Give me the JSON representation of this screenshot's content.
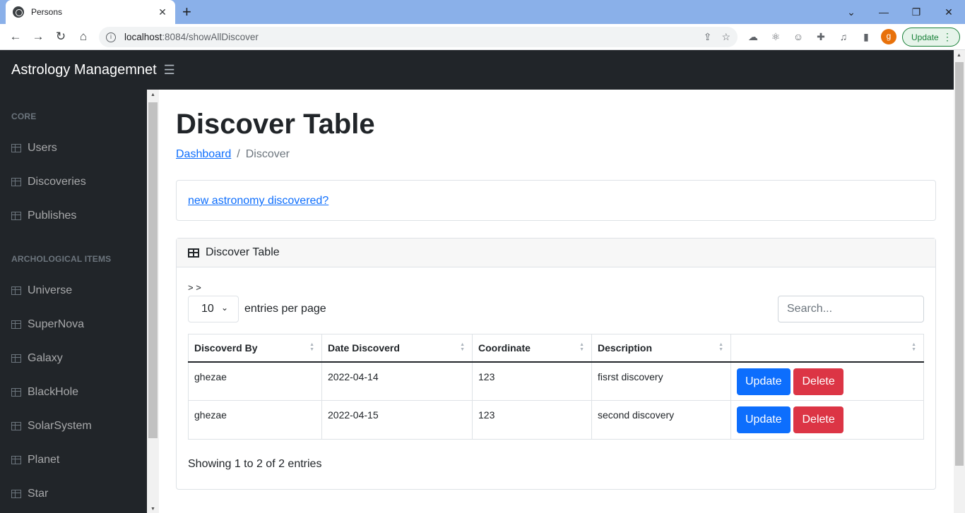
{
  "browser": {
    "tab_title": "Persons",
    "url_host": "localhost",
    "url_rest": ":8084/showAllDiscover",
    "avatar_letter": "g",
    "update_label": "Update"
  },
  "app": {
    "brand": "Astrology Managemnet"
  },
  "sidebar": {
    "core_heading": "CORE",
    "items_core": [
      {
        "label": "Users"
      },
      {
        "label": "Discoveries"
      },
      {
        "label": "Publishes"
      }
    ],
    "items_heading": "ARCHOLOGICAL ITEMS",
    "items_arch": [
      {
        "label": "Universe"
      },
      {
        "label": "SuperNova"
      },
      {
        "label": "Galaxy"
      },
      {
        "label": "BlackHole"
      },
      {
        "label": "SolarSystem"
      },
      {
        "label": "Planet"
      },
      {
        "label": "Star"
      }
    ]
  },
  "main": {
    "title": "Discover Table",
    "breadcrumb_link": "Dashboard",
    "breadcrumb_sep": "/",
    "breadcrumb_current": "Discover",
    "new_link": "new astronomy discovered?",
    "card_title": "Discover Table",
    "pager_text": "> >",
    "per_page_value": "10",
    "per_page_label": "entries per page",
    "search_placeholder": "Search...",
    "columns": [
      "Discoverd By",
      "Date Discoverd",
      "Coordinate",
      "Description",
      ""
    ],
    "rows": [
      {
        "by": "ghezae",
        "date": "2022-04-14",
        "coord": "123",
        "desc": "fisrst discovery"
      },
      {
        "by": "ghezae",
        "date": "2022-04-15",
        "coord": "123",
        "desc": "second discovery"
      }
    ],
    "update_label": "Update",
    "delete_label": "Delete",
    "showing": "Showing 1 to 2 of 2 entries"
  }
}
